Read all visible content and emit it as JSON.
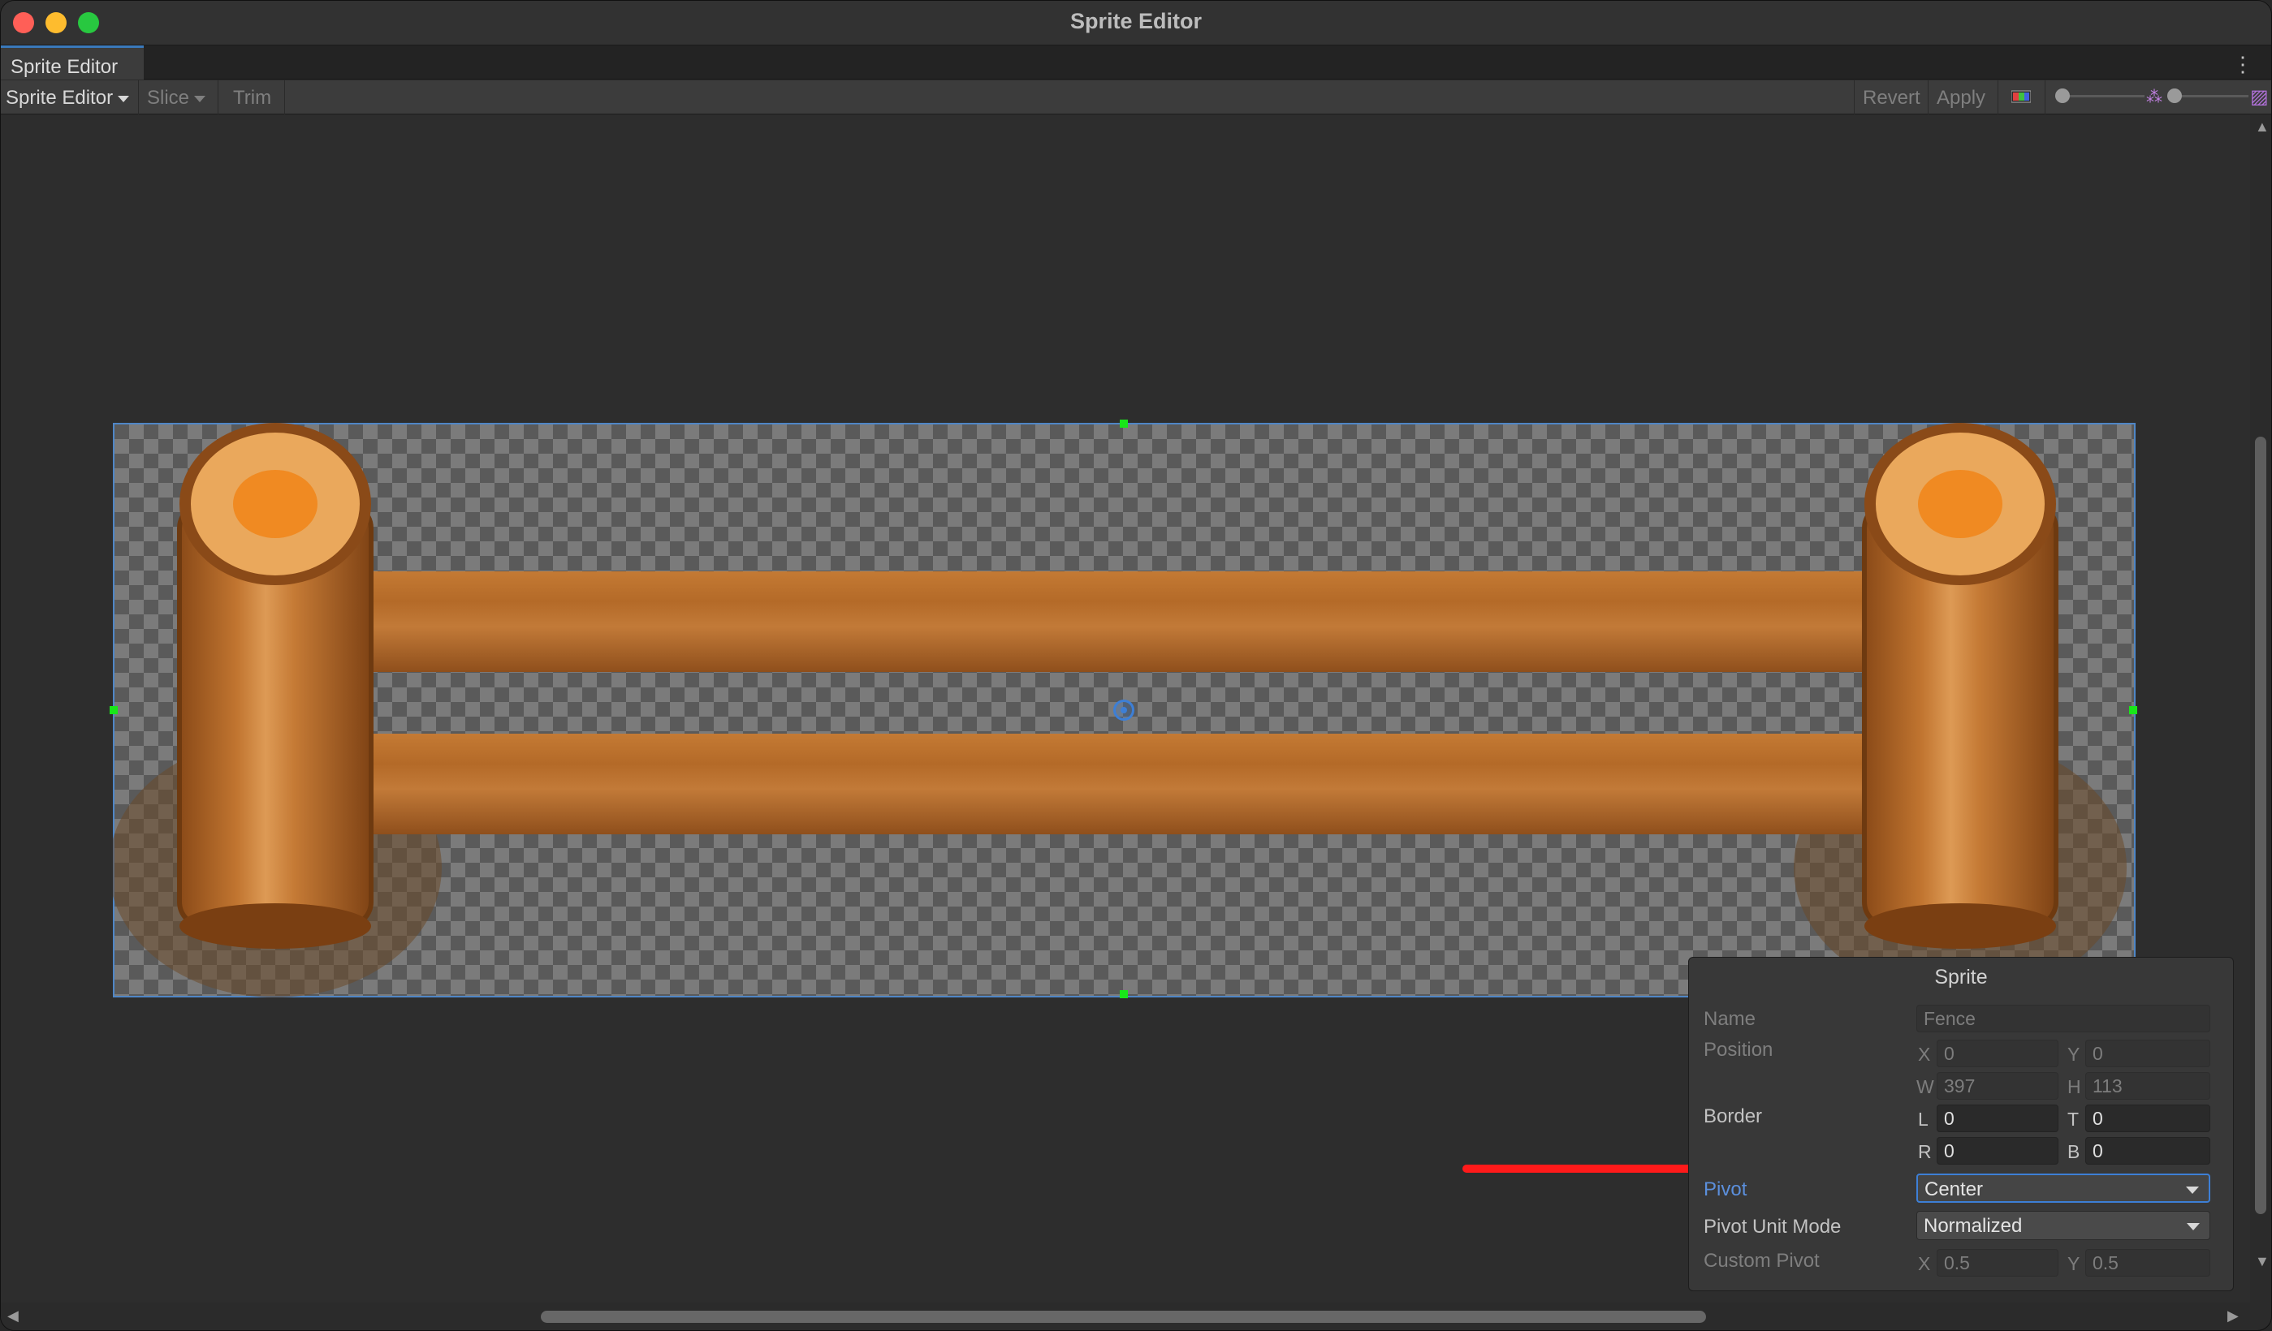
{
  "window": {
    "title": "Sprite Editor"
  },
  "tab": {
    "label": "Sprite Editor"
  },
  "toolbar": {
    "mode_label": "Sprite Editor",
    "slice_label": "Slice",
    "trim_label": "Trim",
    "revert_label": "Revert",
    "apply_label": "Apply"
  },
  "sprite_panel": {
    "title": "Sprite",
    "name_label": "Name",
    "name_value": "Fence",
    "position_label": "Position",
    "x_label": "X",
    "x_value": "0",
    "y_label": "Y",
    "y_value": "0",
    "w_label": "W",
    "w_value": "397",
    "h_label": "H",
    "h_value": "113",
    "border_label": "Border",
    "l_label": "L",
    "l_value": "0",
    "t_label": "T",
    "t_value": "0",
    "r_label": "R",
    "r_value": "0",
    "b_label": "B",
    "b_value": "0",
    "pivot_label": "Pivot",
    "pivot_value": "Center",
    "pivot_unit_label": "Pivot Unit Mode",
    "pivot_unit_value": "Normalized",
    "custom_pivot_label": "Custom Pivot",
    "cx_label": "X",
    "cx_value": "0.5",
    "cy_label": "Y",
    "cy_value": "0.5"
  },
  "colors": {
    "accent": "#3d7fd6",
    "handle": "#19e619",
    "annotation_arrow": "#ff1a1a",
    "wood": "#b5692a"
  },
  "icons": [
    "more-options-icon",
    "color-channel-icon",
    "zoom-slider",
    "mip-slider",
    "alpha-icon"
  ]
}
